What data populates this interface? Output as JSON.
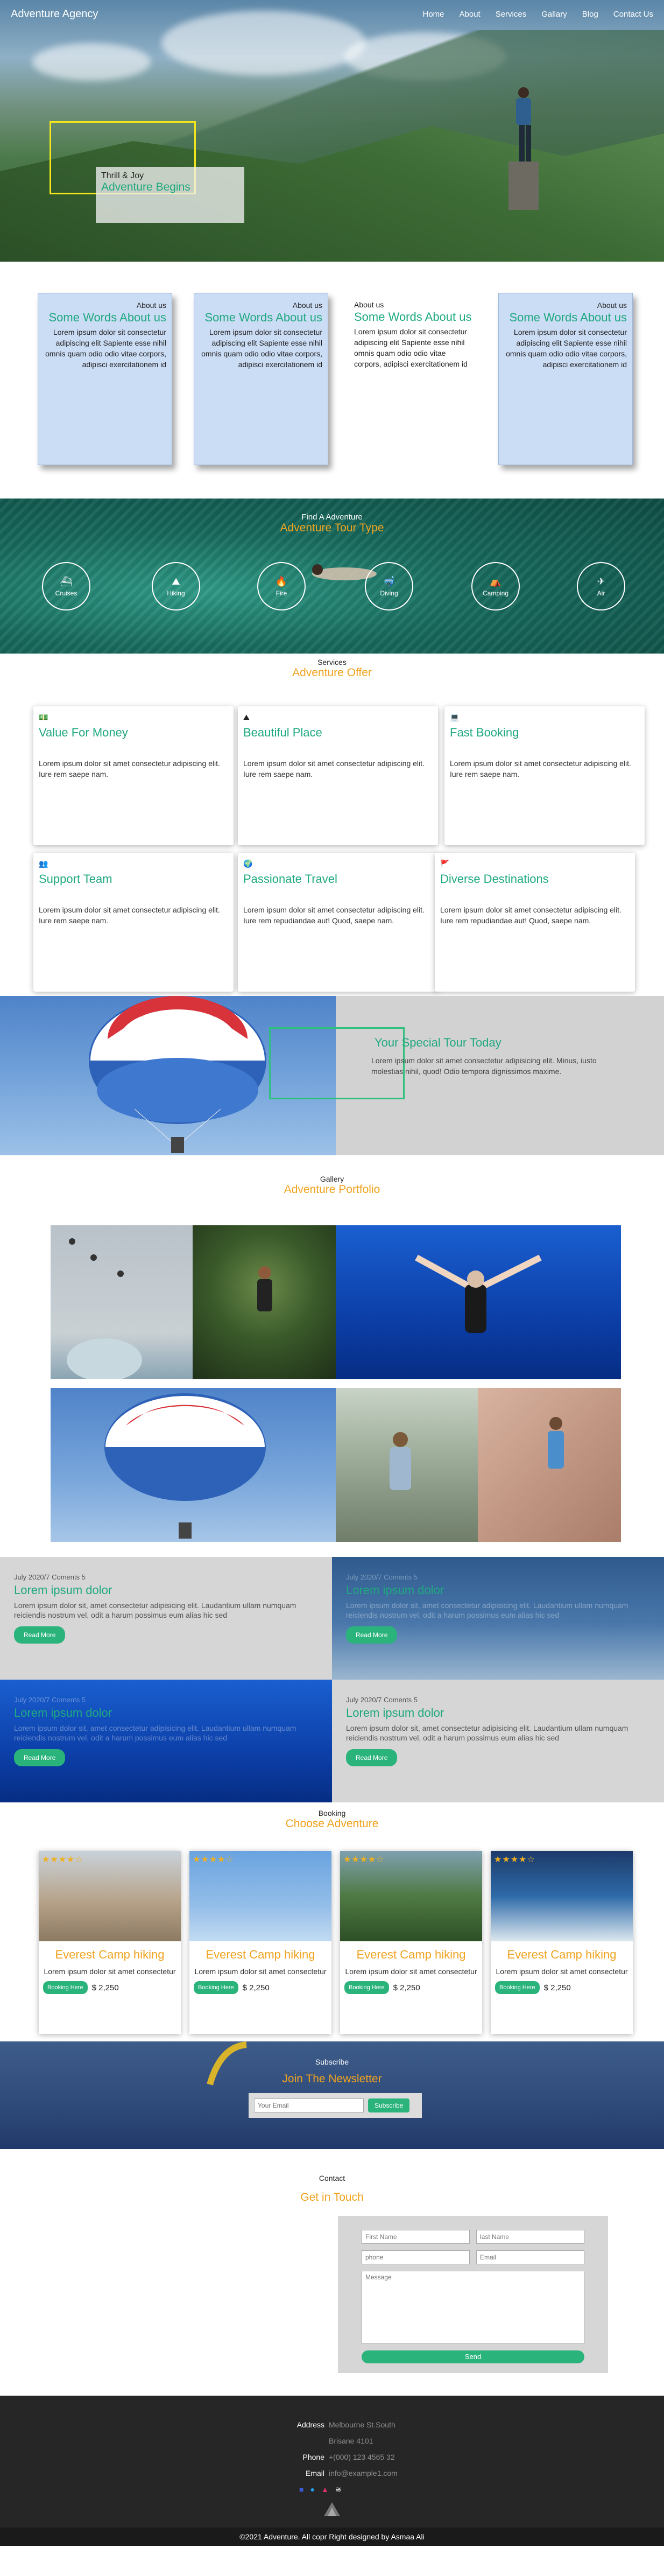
{
  "nav": {
    "brand": "Adventure Agency",
    "items": [
      "Home",
      "About",
      "Services",
      "Gallary",
      "Blog",
      "Contact Us"
    ]
  },
  "hero": {
    "kicker": "Thrill & Joy",
    "title": "Adventure Begins"
  },
  "about": {
    "cards": [
      {
        "small": "About us",
        "title": "Some Words About us",
        "body": "Lorem ipsum dolor sit consectetur adipiscing elit Sapiente esse nihil omnis quam odio odio vitae corpors, adipisci exercitationem id"
      },
      {
        "small": "About us",
        "title": "Some Words About us",
        "body": "Lorem ipsum dolor sit consectetur adipiscing elit Sapiente esse nihil omnis quam odio odio vitae corpors, adipisci exercitationem id"
      },
      {
        "small": "About us",
        "title": "Some Words About us",
        "body": "Lorem ipsum dolor sit consectetur adipiscing elit Sapiente esse nihil omnis quam odio odio vitae corpors, adipisci exercitationem id"
      },
      {
        "small": "About us",
        "title": "Some Words About us",
        "body": "Lorem ipsum dolor sit consectetur adipiscing elit Sapiente esse nihil omnis quam odio odio vitae corpors, adipisci exercitationem id"
      }
    ]
  },
  "types": {
    "small": "Find A Adventure",
    "title": "Adventure Tour Type",
    "items": [
      {
        "label": "Cruises",
        "icon": "ship-icon",
        "glyph": "⛴"
      },
      {
        "label": "Hiking",
        "icon": "hiking-icon",
        "glyph": "⛰"
      },
      {
        "label": "Fire",
        "icon": "fire-icon",
        "glyph": "🔥"
      },
      {
        "label": "Diving",
        "icon": "diving-icon",
        "glyph": "🤿"
      },
      {
        "label": "Camping",
        "icon": "camping-icon",
        "glyph": "⛺"
      },
      {
        "label": "Air",
        "icon": "plane-icon",
        "glyph": "✈"
      }
    ]
  },
  "services": {
    "small": "Services",
    "title": "Adventure Offer",
    "cards": [
      {
        "icon": "money-icon",
        "glyph": "💵",
        "title": "Value For Money",
        "body": "Lorem ipsum dolor sit amet consectetur adipiscing elit. Iure rem saepe nam."
      },
      {
        "icon": "place-icon",
        "glyph": "⛰",
        "title": "Beautiful Place",
        "body": "Lorem ipsum dolor sit amet consectetur adipiscing elit. Iure rem saepe nam."
      },
      {
        "icon": "laptop-icon",
        "glyph": "💻",
        "title": "Fast Booking",
        "body": "Lorem ipsum dolor sit amet consectetur adipiscing elit. Iure rem saepe nam."
      },
      {
        "icon": "team-icon",
        "glyph": "👥",
        "title": "Support Team",
        "body": "Lorem ipsum dolor sit amet consectetur adipiscing elit. Iure rem saepe nam."
      },
      {
        "icon": "globe-icon",
        "glyph": "🌍",
        "title": "Passionate Travel",
        "body": "Lorem ipsum dolor sit amet consectetur adipiscing elit. Iure rem repudiandae aut! Quod, saepe nam."
      },
      {
        "icon": "flag-icon",
        "glyph": "🚩",
        "title": "Diverse Destinations",
        "body": "Lorem ipsum dolor sit amet consectetur adipiscing elit. Iure rem repudiandae aut! Quod, saepe nam."
      }
    ]
  },
  "tour": {
    "title": "Your Special Tour Today",
    "body": "Lorem ipsum dolor sit amet consectetur adipisicing elit. Minus, iusto molestias nihil, quod! Odio tempora dignissimos maxime."
  },
  "gallery": {
    "small": "Gallery",
    "title": "Adventure Portfolio"
  },
  "blog": {
    "posts": [
      {
        "meta": "July 2020/7 Coments 5",
        "title": "Lorem ipsum dolor",
        "body": "Lorem ipsum dolor sit, amet consectetur adipisicing elit. Laudantium ullam numquam reiciendis nostrum vel, odit a harum possimus eum alias hic sed",
        "button": "Read More"
      },
      {
        "meta": "July 2020/7 Coments 5",
        "title": "Lorem ipsum dolor",
        "body": "Lorem ipsum dolor sit, amet consectetur adipisicing elit. Laudantium ullam numquam reiciendis nostrum vel, odit a harum possimus eum alias hic sed",
        "button": "Read More"
      },
      {
        "meta": "July 2020/7 Coments 5",
        "title": "Lorem ipsum dolor",
        "body": "Lorem ipsum dolor sit, amet consectetur adipisicing elit. Laudantium ullam numquam reiciendis nostrum vel, odit a harum possimus eum alias hic sed",
        "button": "Read More"
      },
      {
        "meta": "July 2020/7 Coments 5",
        "title": "Lorem ipsum dolor",
        "body": "Lorem ipsum dolor sit, amet consectetur adipisicing elit. Laudantium ullam numquam reiciendis nostrum vel, odit a harum possimus eum alias hic sed",
        "button": "Read More"
      }
    ]
  },
  "booking": {
    "small": "Booking",
    "title": "Choose Adventure",
    "cards": [
      {
        "title": "Everest Camp hiking",
        "body": "Lorem ipsum dolor sit amet consectetur",
        "button": "Booking Here",
        "price": "$ 2,250",
        "stars": "★★★★☆"
      },
      {
        "title": "Everest Camp hiking",
        "body": "Lorem ipsum dolor sit amet consectetur",
        "button": "Booking Here",
        "price": "$ 2,250",
        "stars": "★★★★☆"
      },
      {
        "title": "Everest Camp hiking",
        "body": "Lorem ipsum dolor sit amet consectetur",
        "button": "Booking Here",
        "price": "$ 2,250",
        "stars": "★★★★☆"
      },
      {
        "title": "Everest Camp hiking",
        "body": "Lorem ipsum dolor sit amet consectetur",
        "button": "Booking Here",
        "price": "$ 2,250",
        "stars": "★★★★☆"
      }
    ]
  },
  "newsletter": {
    "small": "Subscribe",
    "title": "Join The Newsletter",
    "placeholder": "Your Email",
    "button": "Subscribe"
  },
  "contact": {
    "small": "Contact",
    "title": "Get in Touch",
    "first_placeholder": "First Name",
    "last_placeholder": "last Name",
    "phone_placeholder": "phone",
    "email_placeholder": "Email",
    "message_placeholder": "Message",
    "button": "Send"
  },
  "footer": {
    "address_label": "Address",
    "address_line1": "Melbourne St.South",
    "address_line2": "Brisane 4101",
    "phone_label": "Phone",
    "phone": "+(000) 123 4565 32",
    "email_label": "Email",
    "email": "info@example1.com",
    "copyright": "©2021 Adventure. All copr Right designed by Asmaa Ali"
  }
}
